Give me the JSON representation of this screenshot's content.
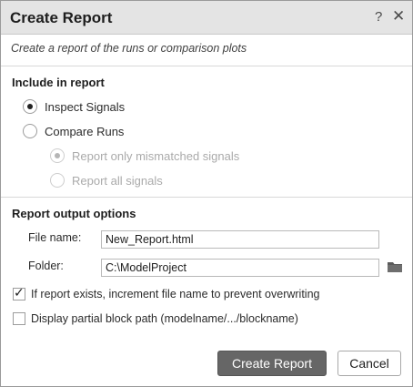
{
  "dialog": {
    "title": "Create Report",
    "help_symbol": "?",
    "close_symbol": "✕",
    "description": "Create a report of the runs or comparison plots"
  },
  "include": {
    "heading": "Include in report",
    "options": [
      {
        "label": "Inspect Signals",
        "selected": true,
        "enabled": true
      },
      {
        "label": "Compare Runs",
        "selected": false,
        "enabled": true
      }
    ],
    "sub_options": [
      {
        "label": "Report only mismatched signals",
        "selected": true,
        "enabled": false
      },
      {
        "label": "Report all signals",
        "selected": false,
        "enabled": false
      }
    ]
  },
  "output": {
    "heading": "Report output options",
    "file_name_label": "File name:",
    "file_name_value": "New_Report.html",
    "folder_label": "Folder:",
    "folder_value": "C:\\ModelProject",
    "folder_icon": "folder-icon",
    "increment_checked": true,
    "increment_label": "If report exists, increment file name to prevent overwriting",
    "partial_path_checked": false,
    "partial_path_label": "Display partial block path (modelname/.../blockname)"
  },
  "buttons": {
    "create_label": "Create Report",
    "cancel_label": "Cancel"
  },
  "colors": {
    "titlebar": "#e4e4e4",
    "primary_button": "#666666",
    "disabled_text": "#aaaaaa"
  }
}
